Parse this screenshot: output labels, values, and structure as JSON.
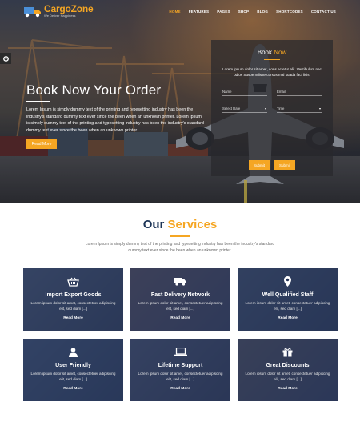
{
  "brand": {
    "name_part1": "Cargo",
    "name_part2": "Zone",
    "tagline": "We Deliver Happiness"
  },
  "nav": {
    "items": [
      {
        "label": "HOME",
        "active": true
      },
      {
        "label": "FEATURES",
        "active": false
      },
      {
        "label": "PAGES",
        "active": false
      },
      {
        "label": "SHOP",
        "active": false
      },
      {
        "label": "BLOG",
        "active": false
      },
      {
        "label": "SHORTCODES",
        "active": false
      },
      {
        "label": "CONTACT US",
        "active": false
      }
    ]
  },
  "hero": {
    "title": "Book Now Your Order",
    "body": "Lorem Ipsum is simply dummy text of the printing and typesetting industry has been the industry's standard dummy text ever since the been when an unknown printer. Lorem Ipsum is simply dummy text of the printing and typesetting industry has been the industry's standard dummy text ever since the been when an unknown printer.",
    "button_label": "Read More"
  },
  "booking": {
    "title_part1": "Book",
    "title_part2": "Now",
    "description": "Lorem ipsum dolor sit amet, cons ectetur elit. Vestibulum nec odios Suspe ndisse cursus mal suada faci lisis.",
    "name_placeholder": "Name",
    "email_placeholder": "Email",
    "date_placeholder": "Select Date",
    "time_placeholder": "Time",
    "submit_label": "Submit",
    "other_label": "Submit"
  },
  "services": {
    "heading_part1": "Our",
    "heading_part2": "Services",
    "description": "Lorem Ipsum is simply dummy text of the printing and typesetting industry has been the industry's standard dummy text ever since the been when an unknown printer.",
    "cards": [
      {
        "icon": "basket-icon",
        "title": "Import Export Goods",
        "text": "Lorem ipsum dolor sit amet, consectetuer adipiscing elit, sed diam [...]",
        "link": "Read More"
      },
      {
        "icon": "truck-icon",
        "title": "Fast Delivery Network",
        "text": "Lorem ipsum dolor sit amet, consectetuer adipiscing elit, sed diam [...]",
        "link": "Read More"
      },
      {
        "icon": "map-pin-icon",
        "title": "Well Qualified Staff",
        "text": "Lorem ipsum dolor sit amet, consectetuer adipiscing elit, sed diam [...]",
        "link": "Read More"
      },
      {
        "icon": "user-icon",
        "title": "User Friendly",
        "text": "Lorem ipsum dolor sit amet, consectetuer adipiscing elit, sed diam [...]",
        "link": "Read More"
      },
      {
        "icon": "laptop-icon",
        "title": "Lifetime Support",
        "text": "Lorem ipsum dolor sit amet, consectetuer adipiscing elit, sed diam [...]",
        "link": "Read More"
      },
      {
        "icon": "gift-icon",
        "title": "Great Discounts",
        "text": "Lorem ipsum dolor sit amet, consectetuer adipiscing elit, sed diam [...]",
        "link": "Read More"
      }
    ]
  },
  "colors": {
    "accent": "#f5a623",
    "navy": "#1d3557",
    "card_overlay": "#263458"
  }
}
